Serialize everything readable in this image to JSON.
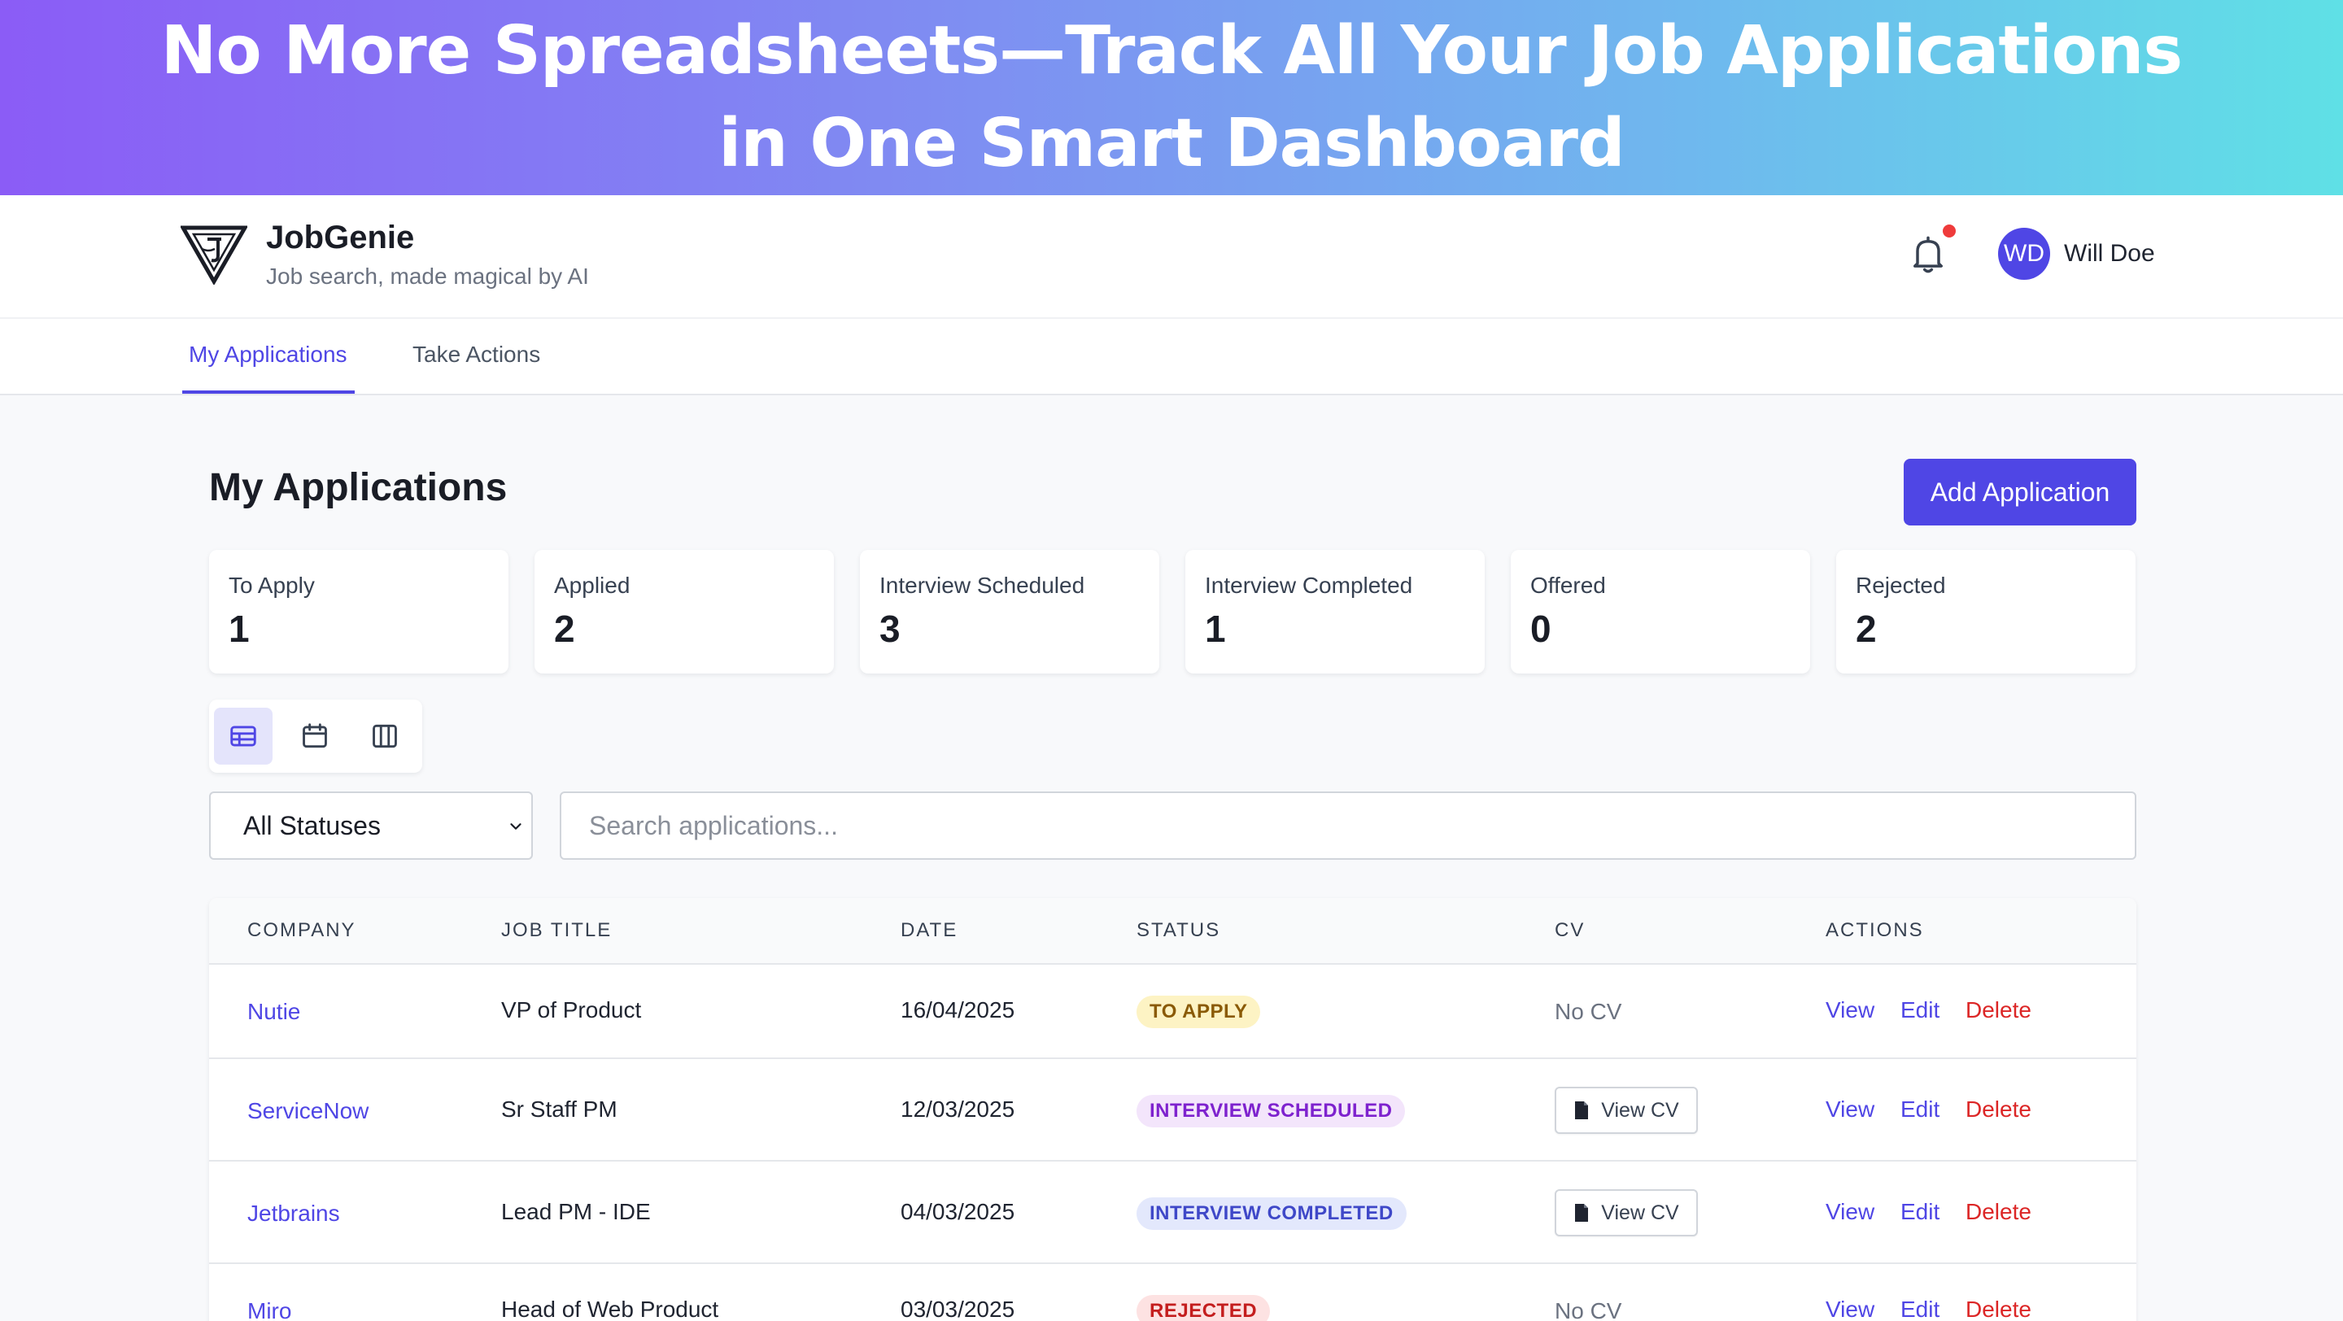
{
  "banner": {
    "line1": "No More Spreadsheets—Track All Your Job Applications",
    "line2": "in One Smart Dashboard"
  },
  "header": {
    "app_name": "JobGenie",
    "tagline": "Job search, made magical by AI",
    "logo_icon": "genie-lamp-logo-icon",
    "notification_icon": "bell-icon",
    "user": {
      "initials": "WD",
      "name": "Will Doe"
    }
  },
  "tabs": [
    {
      "label": "My Applications",
      "active": true
    },
    {
      "label": "Take Actions",
      "active": false
    }
  ],
  "main": {
    "title": "My Applications",
    "add_button": "Add Application"
  },
  "stats": [
    {
      "label": "To Apply",
      "value": "1"
    },
    {
      "label": "Applied",
      "value": "2"
    },
    {
      "label": "Interview Scheduled",
      "value": "3"
    },
    {
      "label": "Interview Completed",
      "value": "1"
    },
    {
      "label": "Offered",
      "value": "0"
    },
    {
      "label": "Rejected",
      "value": "2"
    }
  ],
  "view_modes": [
    {
      "icon": "table-view-icon",
      "active": true
    },
    {
      "icon": "calendar-view-icon",
      "active": false
    },
    {
      "icon": "kanban-view-icon",
      "active": false
    }
  ],
  "filters": {
    "status_selected": "All Statuses",
    "search_placeholder": "Search applications..."
  },
  "table": {
    "headers": [
      "COMPANY",
      "JOB TITLE",
      "DATE",
      "STATUS",
      "CV",
      "ACTIONS"
    ],
    "cv_button_label": "View CV",
    "no_cv_label": "No CV",
    "actions": {
      "view": "View",
      "edit": "Edit",
      "delete": "Delete"
    },
    "rows": [
      {
        "company": "Nutie",
        "job_title": "VP of Product",
        "date": "16/04/2025",
        "status": "TO APPLY",
        "has_cv": false
      },
      {
        "company": "ServiceNow",
        "job_title": "Sr Staff PM",
        "date": "12/03/2025",
        "status": "INTERVIEW SCHEDULED",
        "has_cv": true
      },
      {
        "company": "Jetbrains",
        "job_title": "Lead PM - IDE",
        "date": "04/03/2025",
        "status": "INTERVIEW COMPLETED",
        "has_cv": true
      },
      {
        "company": "Miro",
        "job_title": "Head of Web Product",
        "date": "03/03/2025",
        "status": "REJECTED",
        "has_cv": false
      }
    ]
  },
  "colors": {
    "accent": "#4f46e5",
    "danger": "#dc2626",
    "status": {
      "TO APPLY": {
        "bg": "#fdf3c4",
        "fg": "#8a5a06"
      },
      "INTERVIEW SCHEDULED": {
        "bg": "#f3e5fb",
        "fg": "#7e22ce"
      },
      "INTERVIEW COMPLETED": {
        "bg": "#e3e8fc",
        "fg": "#3f48c8"
      },
      "REJECTED": {
        "bg": "#fde2e2",
        "fg": "#c41e1e"
      }
    }
  }
}
